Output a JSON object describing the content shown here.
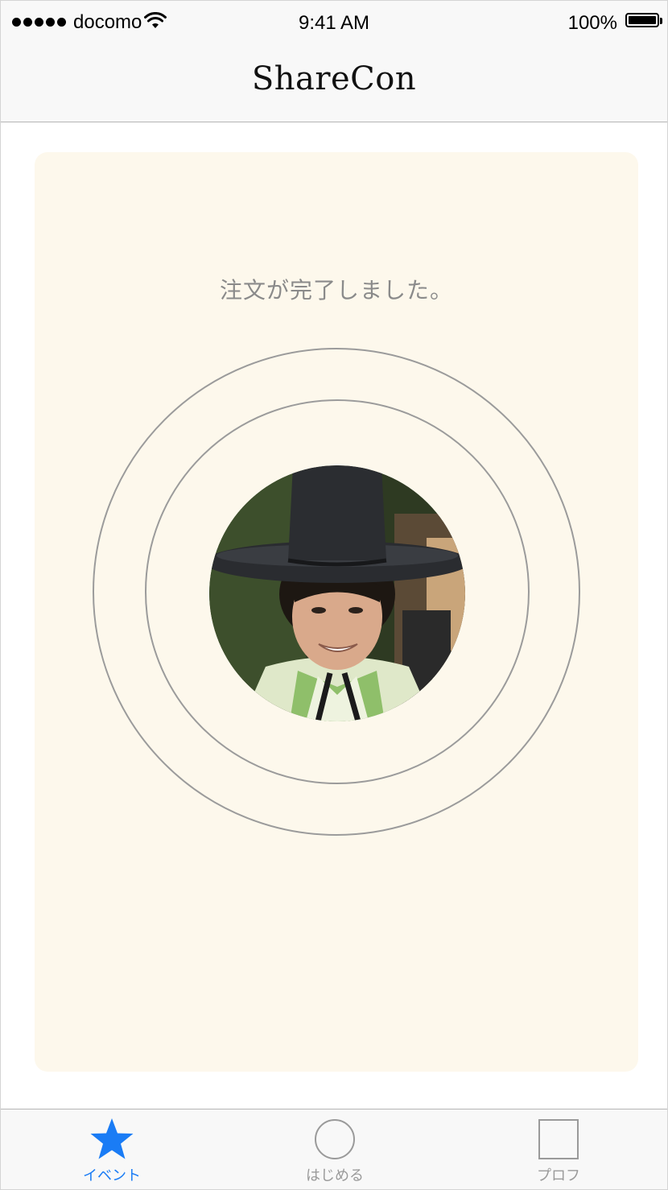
{
  "status_bar": {
    "carrier": "docomo",
    "time": "9:41 AM",
    "battery": "100%"
  },
  "nav": {
    "title": "ShareCon"
  },
  "card": {
    "message": "注文が完了しました。",
    "avatar": "profile-photo"
  },
  "tab_bar": {
    "tabs": [
      {
        "label": "イベント",
        "icon": "star-icon",
        "active": true
      },
      {
        "label": "はじめる",
        "icon": "circle-icon",
        "active": false
      },
      {
        "label": "プロフ",
        "icon": "square-icon",
        "active": false
      }
    ]
  },
  "colors": {
    "accent": "#1a7cf5",
    "card_background": "#fdf8ec",
    "ring": "#9b9b9b",
    "inactive": "#9a9a9a"
  }
}
